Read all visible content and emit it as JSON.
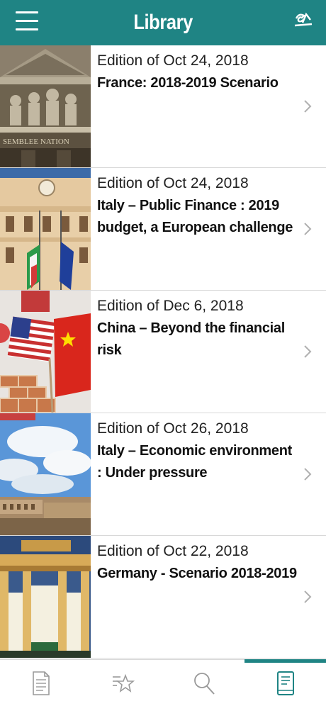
{
  "header": {
    "title": "Library",
    "menu_icon": "hamburger-menu-icon",
    "logo_icon": "ca-logo-icon"
  },
  "articles": [
    {
      "edition": "Edition of Oct 24, 2018",
      "title": "France: 2018-2019 Scenario",
      "image": "french-assembly-pediment"
    },
    {
      "edition": "Edition of Oct 24, 2018",
      "title": "Italy – Public Finance : 2019 budget, a European challenge",
      "image": "italian-palace-flags"
    },
    {
      "edition": "Edition of Dec 6, 2018",
      "title": "China – Beyond the financial risk",
      "image": "us-china-flags-bricks"
    },
    {
      "edition": "Edition of Oct 26, 2018",
      "title": "Italy – Economic environment : Under pressure",
      "image": "rome-sky-clouds"
    },
    {
      "edition": "Edition of Oct 22, 2018",
      "title": "Germany - Scenario 2018-2019",
      "image": "brandenburg-gate-night"
    }
  ],
  "tabs": [
    {
      "name": "document-tab",
      "icon": "document-icon",
      "active": false
    },
    {
      "name": "favorites-tab",
      "icon": "star-list-icon",
      "active": false
    },
    {
      "name": "search-tab",
      "icon": "search-icon",
      "active": false
    },
    {
      "name": "library-tab",
      "icon": "library-book-icon",
      "active": true
    }
  ],
  "colors": {
    "accent": "#1f8484",
    "chevron": "#b0b0b0",
    "icon_gray": "#9a9a9a"
  }
}
